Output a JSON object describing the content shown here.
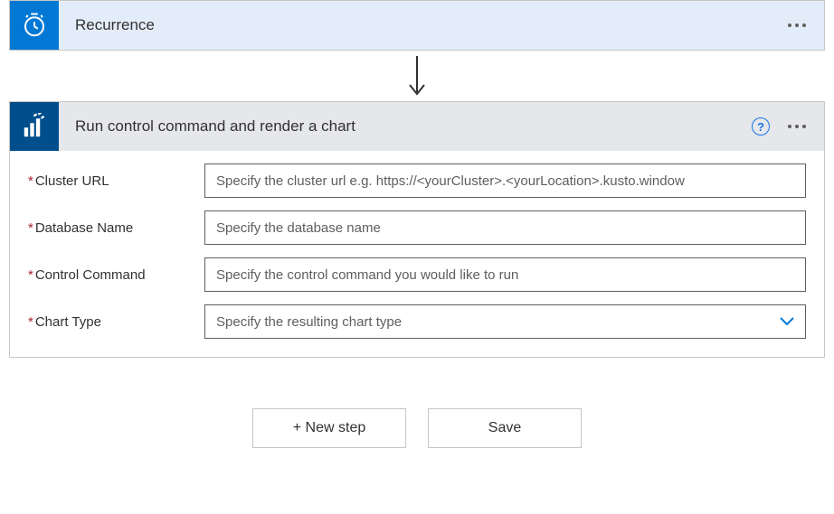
{
  "recurrence": {
    "title": "Recurrence"
  },
  "action": {
    "title": "Run control command and render a chart",
    "fields": {
      "cluster_url": {
        "label": "Cluster URL",
        "placeholder": "Specify the cluster url e.g. https://<yourCluster>.<yourLocation>.kusto.window"
      },
      "database_name": {
        "label": "Database Name",
        "placeholder": "Specify the database name"
      },
      "control_command": {
        "label": "Control Command",
        "placeholder": "Specify the control command you would like to run"
      },
      "chart_type": {
        "label": "Chart Type",
        "placeholder": "Specify the resulting chart type"
      }
    }
  },
  "buttons": {
    "new_step": "+ New step",
    "save": "Save"
  },
  "glyphs": {
    "help": "?"
  }
}
